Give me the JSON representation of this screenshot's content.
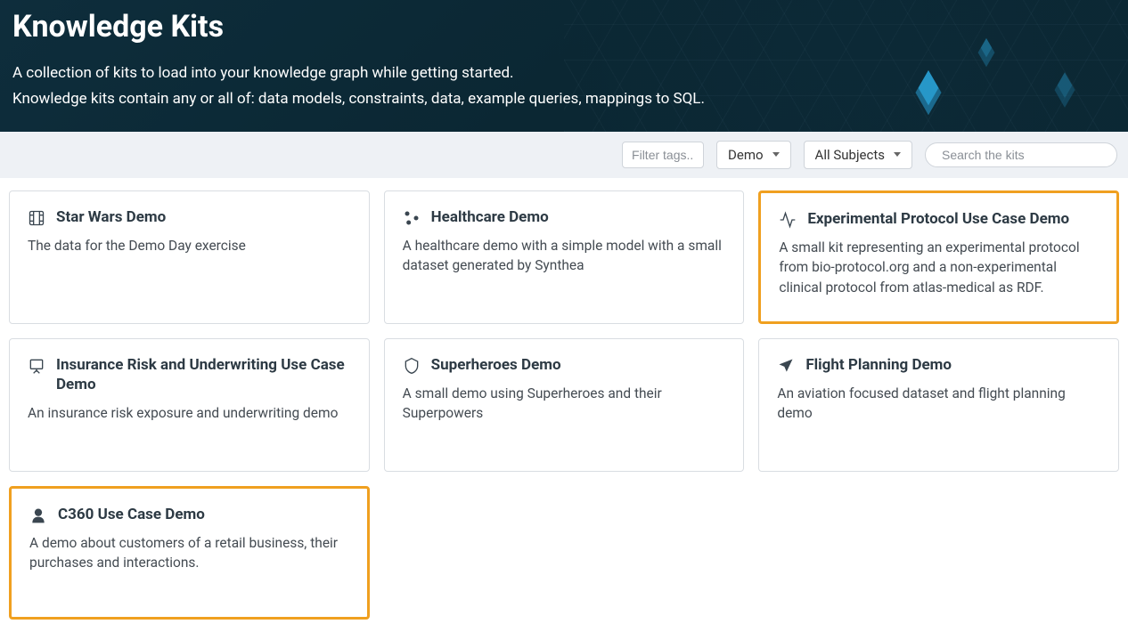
{
  "header": {
    "title": "Knowledge Kits",
    "line1": "A collection of kits to load into your knowledge graph while getting started.",
    "line2": "Knowledge kits contain any or all of: data models, constraints, data, example queries, mappings to SQL."
  },
  "filters": {
    "tags_placeholder": "Filter tags..",
    "demo_label": "Demo",
    "subjects_label": "All Subjects",
    "search_placeholder": "Search the kits"
  },
  "kits": [
    {
      "icon": "film",
      "title": "Star Wars Demo",
      "desc": "The data for the Demo Day exercise",
      "highlight": false
    },
    {
      "icon": "share",
      "title": "Healthcare Demo",
      "desc": "A healthcare demo with a simple model with a small dataset generated by Synthea",
      "highlight": false
    },
    {
      "icon": "activity",
      "title": "Experimental Protocol Use Case Demo",
      "desc": "A small kit representing an experimental protocol from bio-protocol.org and a non-experimental clinical protocol from atlas-medical as RDF.",
      "highlight": true
    },
    {
      "icon": "presentation",
      "title": "Insurance Risk and Underwriting Use Case Demo",
      "desc": "An insurance risk exposure and underwriting demo",
      "highlight": false
    },
    {
      "icon": "shield",
      "title": "Superheroes Demo",
      "desc": "A small demo using Superheroes and their Superpowers",
      "highlight": false
    },
    {
      "icon": "plane",
      "title": "Flight Planning Demo",
      "desc": "An aviation focused dataset and flight planning demo",
      "highlight": false
    },
    {
      "icon": "user",
      "title": "C360 Use Case Demo",
      "desc": "A demo about customers of a retail business, their purchases and interactions.",
      "highlight": true
    }
  ]
}
